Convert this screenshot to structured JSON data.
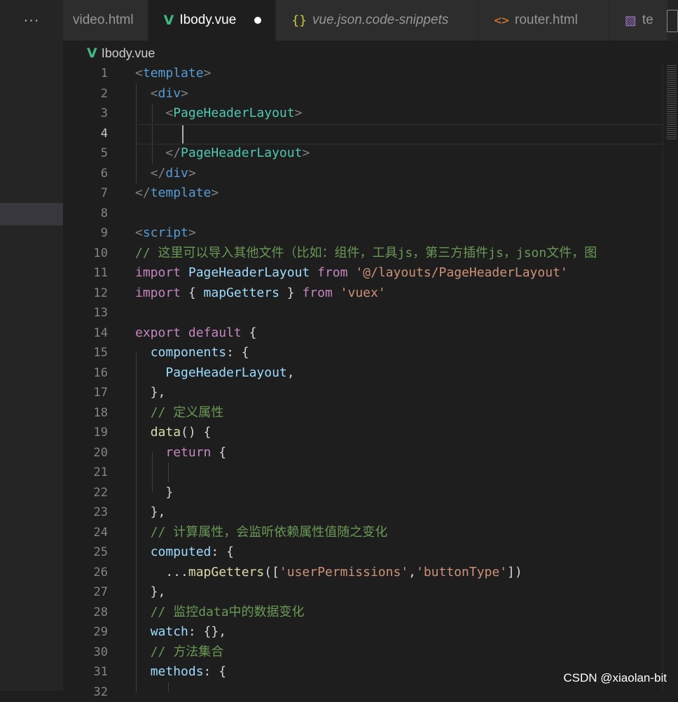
{
  "tabs": [
    {
      "label": "video.html",
      "icon": "html-icon"
    },
    {
      "label": "Ibody.vue",
      "icon": "vue-icon",
      "active": true,
      "modified": true
    },
    {
      "label": "vue.json.code-snippets",
      "icon": "json-icon"
    },
    {
      "label": "router.html",
      "icon": "html-icon"
    },
    {
      "label": "te",
      "icon": "image-icon"
    }
  ],
  "more_label": "···",
  "breadcrumb": {
    "icon": "V",
    "file": "Ibody.vue"
  },
  "icons": {
    "vue": "V",
    "json": "{}",
    "html": "<>",
    "image": "▨"
  },
  "lines": [
    {
      "n": "1",
      "tokens": [
        [
          "tag",
          "<"
        ],
        [
          "name",
          "template"
        ],
        [
          "tag",
          ">"
        ]
      ]
    },
    {
      "n": "2",
      "tokens": [
        [
          "pl",
          "  "
        ],
        [
          "tag",
          "<"
        ],
        [
          "name",
          "div"
        ],
        [
          "tag",
          ">"
        ]
      ]
    },
    {
      "n": "3",
      "tokens": [
        [
          "pl",
          "    "
        ],
        [
          "tag",
          "<"
        ],
        [
          "comp",
          "PageHeaderLayout"
        ],
        [
          "tag",
          ">"
        ]
      ]
    },
    {
      "n": "4",
      "tokens": [],
      "current": true
    },
    {
      "n": "5",
      "tokens": [
        [
          "pl",
          "    "
        ],
        [
          "tag",
          "</"
        ],
        [
          "comp",
          "PageHeaderLayout"
        ],
        [
          "tag",
          ">"
        ]
      ]
    },
    {
      "n": "6",
      "tokens": [
        [
          "pl",
          "  "
        ],
        [
          "tag",
          "</"
        ],
        [
          "name",
          "div"
        ],
        [
          "tag",
          ">"
        ]
      ]
    },
    {
      "n": "7",
      "tokens": [
        [
          "tag",
          "</"
        ],
        [
          "name",
          "template"
        ],
        [
          "tag",
          ">"
        ]
      ]
    },
    {
      "n": "8",
      "tokens": []
    },
    {
      "n": "9",
      "tokens": [
        [
          "tag",
          "<"
        ],
        [
          "name",
          "script"
        ],
        [
          "tag",
          ">"
        ]
      ]
    },
    {
      "n": "10",
      "tokens": [
        [
          "cmt",
          "// 这里可以导入其他文件（比如：组件，工具js，第三方插件js，json文件，图"
        ]
      ]
    },
    {
      "n": "11",
      "tokens": [
        [
          "kw",
          "import"
        ],
        [
          "pl",
          " "
        ],
        [
          "var",
          "PageHeaderLayout"
        ],
        [
          "pl",
          " "
        ],
        [
          "kw",
          "from"
        ],
        [
          "pl",
          " "
        ],
        [
          "str",
          "'@/layouts/PageHeaderLayout'"
        ]
      ]
    },
    {
      "n": "12",
      "tokens": [
        [
          "kw",
          "import"
        ],
        [
          "pl",
          " { "
        ],
        [
          "var",
          "mapGetters"
        ],
        [
          "pl",
          " } "
        ],
        [
          "kw",
          "from"
        ],
        [
          "pl",
          " "
        ],
        [
          "str",
          "'vuex'"
        ]
      ]
    },
    {
      "n": "13",
      "tokens": []
    },
    {
      "n": "14",
      "tokens": [
        [
          "kw",
          "export"
        ],
        [
          "pl",
          " "
        ],
        [
          "kw",
          "default"
        ],
        [
          "pl",
          " {"
        ]
      ]
    },
    {
      "n": "15",
      "tokens": [
        [
          "pl",
          "  "
        ],
        [
          "var",
          "components"
        ],
        [
          "pl",
          ": {"
        ]
      ]
    },
    {
      "n": "16",
      "tokens": [
        [
          "pl",
          "    "
        ],
        [
          "var",
          "PageHeaderLayout"
        ],
        [
          "pl",
          ","
        ]
      ]
    },
    {
      "n": "17",
      "tokens": [
        [
          "pl",
          "  },"
        ]
      ]
    },
    {
      "n": "18",
      "tokens": [
        [
          "pl",
          "  "
        ],
        [
          "cmt",
          "// 定义属性"
        ]
      ]
    },
    {
      "n": "19",
      "tokens": [
        [
          "pl",
          "  "
        ],
        [
          "fn",
          "data"
        ],
        [
          "pl",
          "() {"
        ]
      ]
    },
    {
      "n": "20",
      "tokens": [
        [
          "pl",
          "    "
        ],
        [
          "kw",
          "return"
        ],
        [
          "pl",
          " {"
        ]
      ]
    },
    {
      "n": "21",
      "tokens": []
    },
    {
      "n": "22",
      "tokens": [
        [
          "pl",
          "    }"
        ]
      ]
    },
    {
      "n": "23",
      "tokens": [
        [
          "pl",
          "  },"
        ]
      ]
    },
    {
      "n": "24",
      "tokens": [
        [
          "pl",
          "  "
        ],
        [
          "cmt",
          "// 计算属性，会监听依赖属性值随之变化"
        ]
      ]
    },
    {
      "n": "25",
      "tokens": [
        [
          "pl",
          "  "
        ],
        [
          "var",
          "computed"
        ],
        [
          "pl",
          ": {"
        ]
      ]
    },
    {
      "n": "26",
      "tokens": [
        [
          "pl",
          "    ..."
        ],
        [
          "fn",
          "mapGetters"
        ],
        [
          "pl",
          "(["
        ],
        [
          "str",
          "'userPermissions'"
        ],
        [
          "pl",
          ","
        ],
        [
          "str",
          "'buttonType'"
        ],
        [
          "pl",
          "])"
        ]
      ]
    },
    {
      "n": "27",
      "tokens": [
        [
          "pl",
          "  },"
        ]
      ]
    },
    {
      "n": "28",
      "tokens": [
        [
          "pl",
          "  "
        ],
        [
          "cmt",
          "// 监控data中的数据变化"
        ]
      ]
    },
    {
      "n": "29",
      "tokens": [
        [
          "pl",
          "  "
        ],
        [
          "var",
          "watch"
        ],
        [
          "pl",
          ": {},"
        ]
      ]
    },
    {
      "n": "30",
      "tokens": [
        [
          "pl",
          "  "
        ],
        [
          "cmt",
          "// 方法集合"
        ]
      ]
    },
    {
      "n": "31",
      "tokens": [
        [
          "pl",
          "  "
        ],
        [
          "var",
          "methods"
        ],
        [
          "pl",
          ": {"
        ]
      ]
    },
    {
      "n": "32",
      "tokens": []
    }
  ],
  "watermark": "CSDN @xiaolan-bit"
}
